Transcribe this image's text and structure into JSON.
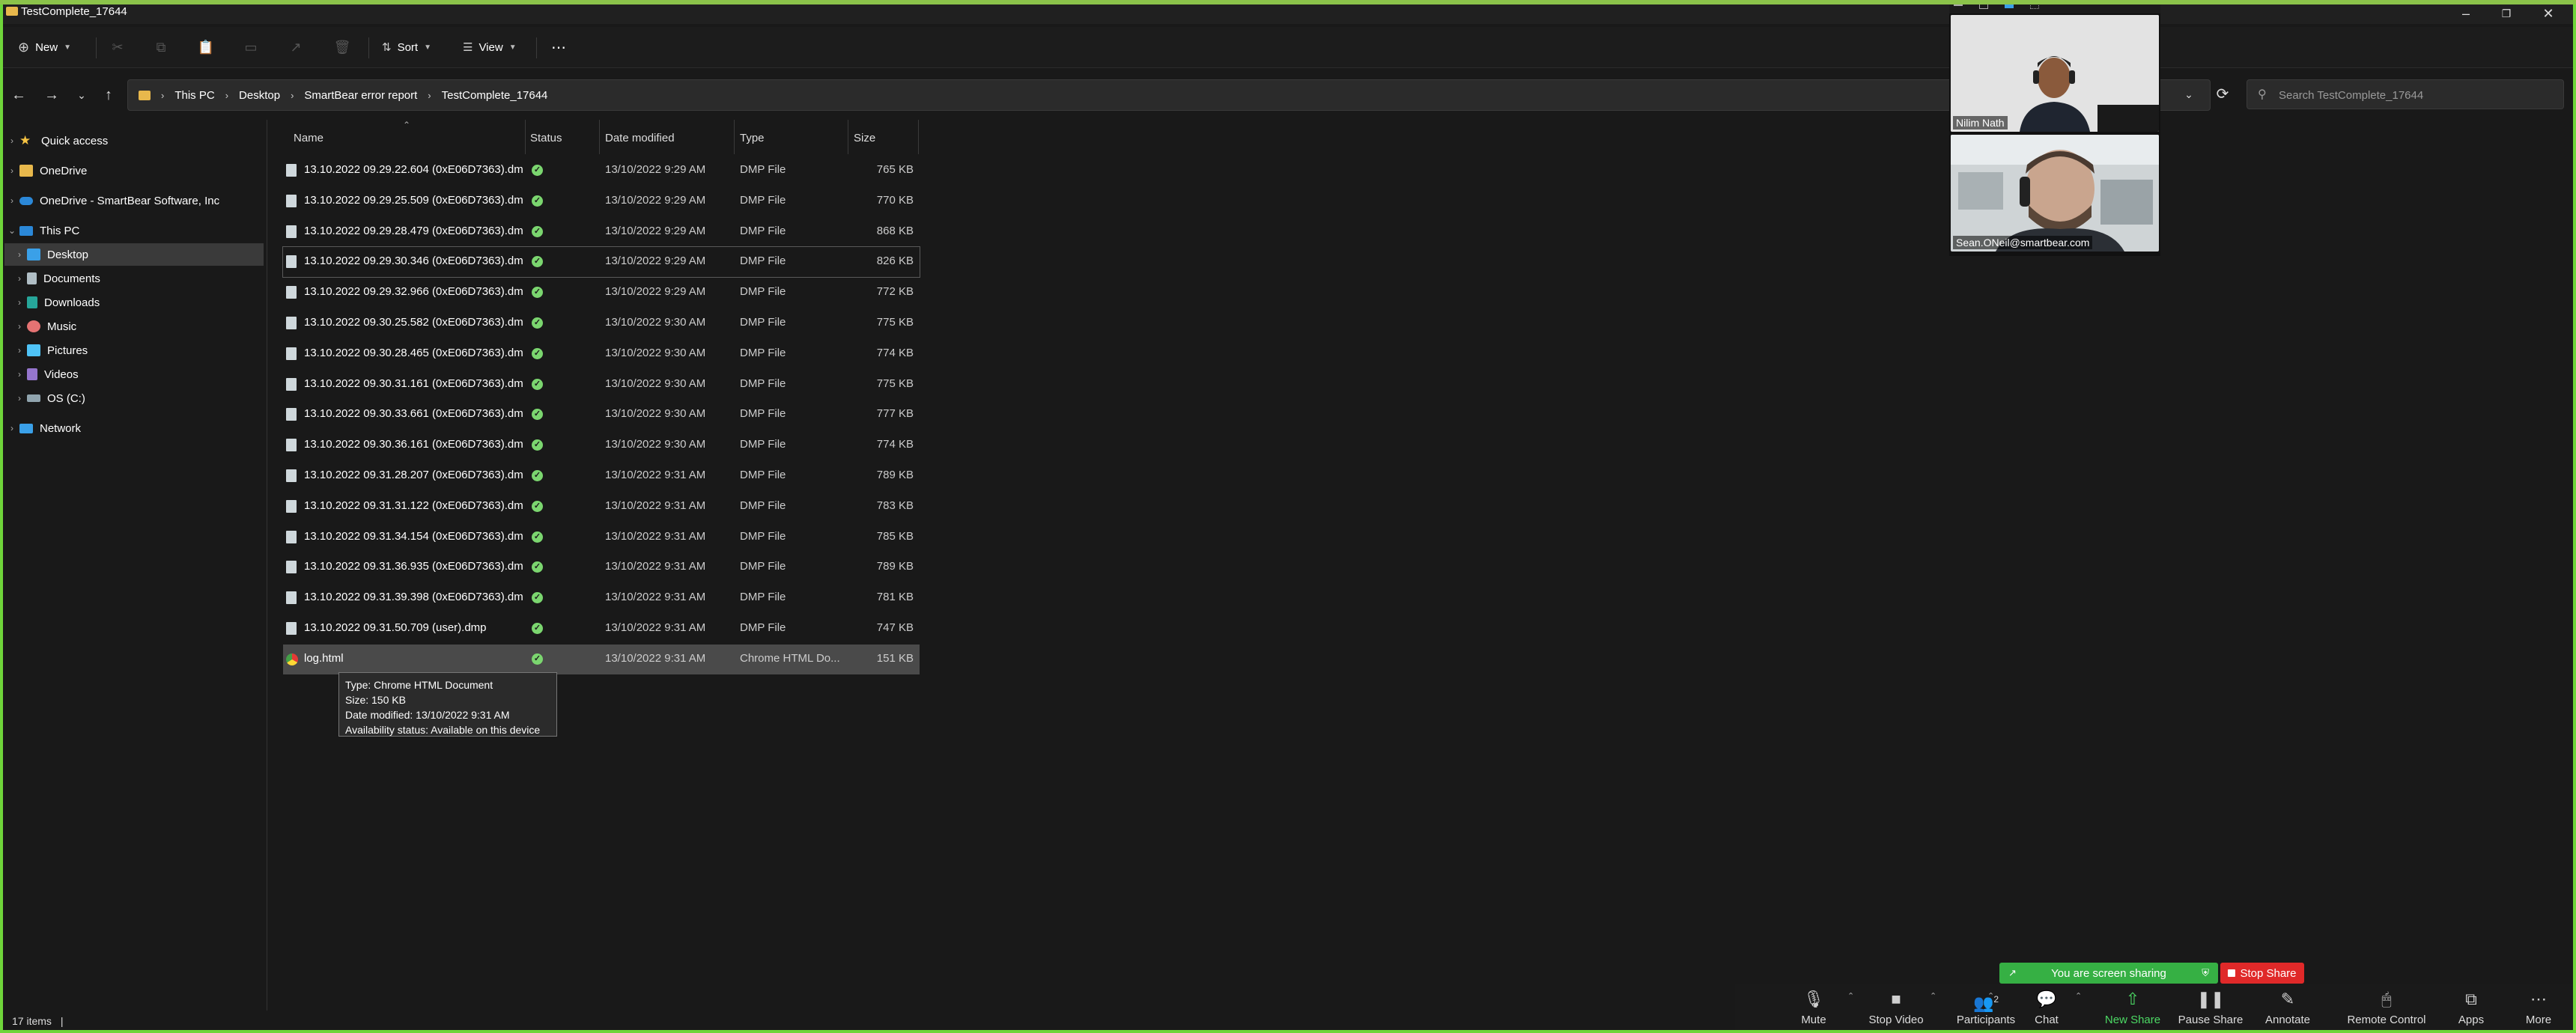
{
  "window": {
    "title": "TestComplete_17644"
  },
  "toolbar": {
    "new_label": "New",
    "sort_label": "Sort",
    "view_label": "View",
    "more_label": "⋯"
  },
  "address": {
    "breadcrumbs": [
      "This PC",
      "Desktop",
      "SmartBear error report",
      "TestComplete_17644"
    ],
    "search_placeholder": "Search TestComplete_17644"
  },
  "nav": {
    "items": [
      {
        "label": "Quick access"
      },
      {
        "label": "OneDrive"
      },
      {
        "label": "OneDrive - SmartBear Software, Inc"
      },
      {
        "label": "This PC"
      },
      {
        "label": "Desktop"
      },
      {
        "label": "Documents"
      },
      {
        "label": "Downloads"
      },
      {
        "label": "Music"
      },
      {
        "label": "Pictures"
      },
      {
        "label": "Videos"
      },
      {
        "label": "OS (C:)"
      },
      {
        "label": "Network"
      }
    ]
  },
  "columns": {
    "name": "Name",
    "status": "Status",
    "date": "Date modified",
    "type": "Type",
    "size": "Size"
  },
  "files": [
    {
      "name": "13.10.2022 09.29.22.604 (0xE06D7363).dmp",
      "date": "13/10/2022 9:29 AM",
      "type": "DMP File",
      "size": "765 KB"
    },
    {
      "name": "13.10.2022 09.29.25.509 (0xE06D7363).dmp",
      "date": "13/10/2022 9:29 AM",
      "type": "DMP File",
      "size": "770 KB"
    },
    {
      "name": "13.10.2022 09.29.28.479 (0xE06D7363).dmp",
      "date": "13/10/2022 9:29 AM",
      "type": "DMP File",
      "size": "868 KB"
    },
    {
      "name": "13.10.2022 09.29.30.346 (0xE06D7363).dmp",
      "date": "13/10/2022 9:29 AM",
      "type": "DMP File",
      "size": "826 KB"
    },
    {
      "name": "13.10.2022 09.29.32.966 (0xE06D7363).dmp",
      "date": "13/10/2022 9:29 AM",
      "type": "DMP File",
      "size": "772 KB"
    },
    {
      "name": "13.10.2022 09.30.25.582 (0xE06D7363).dmp",
      "date": "13/10/2022 9:30 AM",
      "type": "DMP File",
      "size": "775 KB"
    },
    {
      "name": "13.10.2022 09.30.28.465 (0xE06D7363).dmp",
      "date": "13/10/2022 9:30 AM",
      "type": "DMP File",
      "size": "774 KB"
    },
    {
      "name": "13.10.2022 09.30.31.161 (0xE06D7363).dmp",
      "date": "13/10/2022 9:30 AM",
      "type": "DMP File",
      "size": "775 KB"
    },
    {
      "name": "13.10.2022 09.30.33.661 (0xE06D7363).dmp",
      "date": "13/10/2022 9:30 AM",
      "type": "DMP File",
      "size": "777 KB"
    },
    {
      "name": "13.10.2022 09.30.36.161 (0xE06D7363).dmp",
      "date": "13/10/2022 9:30 AM",
      "type": "DMP File",
      "size": "774 KB"
    },
    {
      "name": "13.10.2022 09.31.28.207 (0xE06D7363).dmp",
      "date": "13/10/2022 9:31 AM",
      "type": "DMP File",
      "size": "789 KB"
    },
    {
      "name": "13.10.2022 09.31.31.122 (0xE06D7363).dmp",
      "date": "13/10/2022 9:31 AM",
      "type": "DMP File",
      "size": "783 KB"
    },
    {
      "name": "13.10.2022 09.31.34.154 (0xE06D7363).dmp",
      "date": "13/10/2022 9:31 AM",
      "type": "DMP File",
      "size": "785 KB"
    },
    {
      "name": "13.10.2022 09.31.36.935 (0xE06D7363).dmp",
      "date": "13/10/2022 9:31 AM",
      "type": "DMP File",
      "size": "789 KB"
    },
    {
      "name": "13.10.2022 09.31.39.398 (0xE06D7363).dmp",
      "date": "13/10/2022 9:31 AM",
      "type": "DMP File",
      "size": "781 KB"
    },
    {
      "name": "13.10.2022 09.31.50.709 (user).dmp",
      "date": "13/10/2022 9:31 AM",
      "type": "DMP File",
      "size": "747 KB"
    },
    {
      "name": "log.html",
      "date": "13/10/2022 9:31 AM",
      "type": "Chrome HTML Do...",
      "size": "151 KB"
    }
  ],
  "tooltip": {
    "type": "Type: Chrome HTML Document",
    "size": "Size: 150 KB",
    "date": "Date modified: 13/10/2022 9:31 AM",
    "availability": "Availability status: Available on this device"
  },
  "statusbar": {
    "count": "17 items",
    "sep": "|"
  },
  "video": {
    "participants": [
      {
        "name": "Nilim Nath"
      },
      {
        "name": "Sean.ONeil@smartbear.com"
      }
    ]
  },
  "share": {
    "sharing_label": "You are screen sharing",
    "stop_label": "Stop Share"
  },
  "zoom_toolbar": {
    "participants_count": "2",
    "items": [
      {
        "label": "Mute"
      },
      {
        "label": "Stop Video"
      },
      {
        "label": "Participants"
      },
      {
        "label": "Chat"
      },
      {
        "label": "New Share"
      },
      {
        "label": "Pause Share"
      },
      {
        "label": "Annotate"
      },
      {
        "label": "Remote Control"
      },
      {
        "label": "Apps"
      },
      {
        "label": "More"
      }
    ]
  },
  "colors": {
    "share_green": "#36b044",
    "stop_red": "#e02929",
    "border_green": "#6fd53a",
    "folder": "#e8b84c"
  }
}
